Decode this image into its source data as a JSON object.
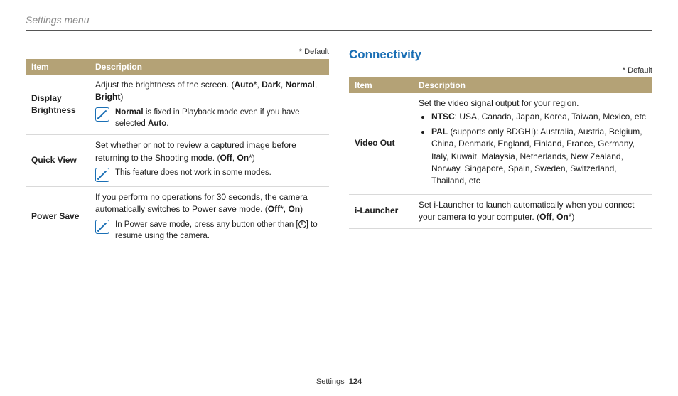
{
  "breadcrumb": "Settings menu",
  "default_label": "* Default",
  "headers": {
    "item": "Item",
    "desc": "Description"
  },
  "left": {
    "rows": {
      "display_brightness": {
        "item": "Display Brightness",
        "desc_pre": "Adjust the brightness of the screen. (",
        "opt_auto": "Auto",
        "opt_dark": "Dark",
        "opt_normal": "Normal",
        "opt_bright": "Bright",
        "note_b": "Normal",
        "note_rest": " is fixed in Playback mode even if you have selected ",
        "note_b2": "Auto",
        "note_end": "."
      },
      "quick_view": {
        "item": "Quick View",
        "desc_pre": "Set whether or not to review a captured image before returning to the Shooting mode. (",
        "opt_off": "Off",
        "opt_on": "On",
        "note": "This feature does not work in some modes."
      },
      "power_save": {
        "item": "Power Save",
        "desc_pre": "If you perform no operations for 30 seconds, the camera automatically switches to Power save mode. (",
        "opt_off": "Off",
        "opt_on": "On",
        "note_a": "In Power save mode, press any button other than [",
        "note_b": "] to resume using the camera."
      }
    }
  },
  "right": {
    "title": "Connectivity",
    "rows": {
      "video_out": {
        "item": "Video Out",
        "lead": "Set the video signal output for your region.",
        "ntsc_b": "NTSC",
        "ntsc_rest": ": USA, Canada, Japan, Korea, Taiwan, Mexico, etc",
        "pal_b": "PAL",
        "pal_rest": " (supports only BDGHI): Australia, Austria, Belgium, China, Denmark, England, Finland, France, Germany, Italy, Kuwait, Malaysia, Netherlands, New Zealand, Norway, Singapore, Spain, Sweden, Switzerland, Thailand, etc"
      },
      "ilauncher": {
        "item": "i-Launcher",
        "desc_pre": "Set i-Launcher to launch automatically when you connect your camera to your computer. (",
        "opt_off": "Off",
        "opt_on": "On"
      }
    }
  },
  "footer": {
    "section": "Settings",
    "page": "124"
  }
}
